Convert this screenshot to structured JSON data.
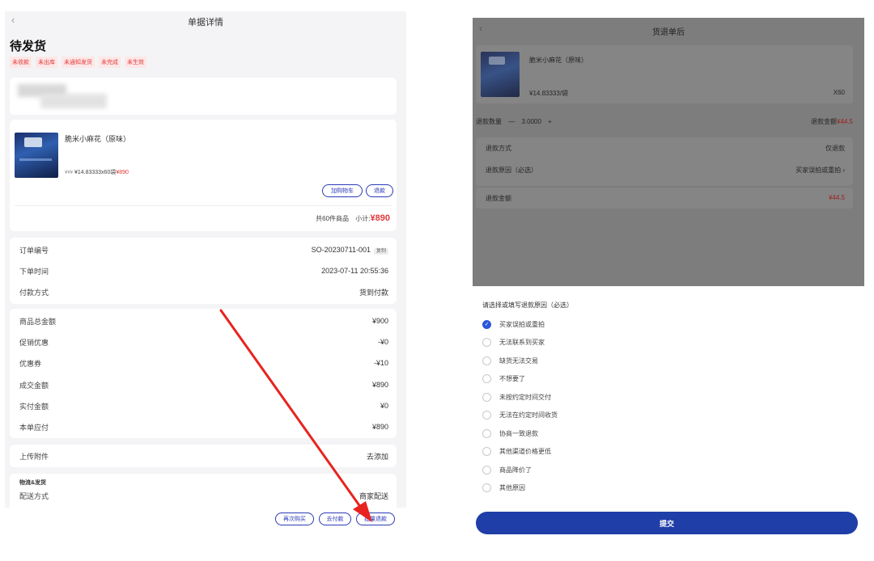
{
  "left": {
    "nav_title": "单据详情",
    "back_icon": "chevron-left-icon",
    "status": "待发货",
    "tags": [
      "未收款",
      "未出库",
      "未通知发货",
      "未完成",
      "未生效"
    ],
    "product": {
      "name": "脆米小麻花（原味）",
      "price_line": "¥14.83333x60袋",
      "price_prefix": "¥¥¥",
      "price_total": "¥890",
      "add_cart_label": "加购物车",
      "refund_label": "退款",
      "summary_count": "共60件商品",
      "summary_subtotal_label": "小计:",
      "summary_subtotal_value": "¥890"
    },
    "order_info": [
      {
        "label": "订单编号",
        "value": "SO-20230711-001",
        "badge": "复制"
      },
      {
        "label": "下单时间",
        "value": "2023-07-11 20:55:36"
      },
      {
        "label": "付款方式",
        "value": "货到付款"
      }
    ],
    "amounts": [
      {
        "label": "商品总金额",
        "value": "¥900",
        "red": false
      },
      {
        "label": "促销优惠",
        "value": "-¥0",
        "red": true
      },
      {
        "label": "优惠券",
        "value": "-¥10",
        "red": true
      },
      {
        "label": "成交金额",
        "value": "¥890",
        "red": false
      },
      {
        "label": "实付金额",
        "value": "¥0",
        "red": false
      },
      {
        "label": "本单应付",
        "value": "¥890",
        "red": false
      }
    ],
    "attachment": {
      "label": "上传附件",
      "action": "去添加"
    },
    "logistics": {
      "header": "物流&发货",
      "label": "配送方式",
      "value": "商家配送"
    },
    "bottom_buttons": [
      "再次购买",
      "去付款",
      "批量退款"
    ],
    "colors": {
      "accent": "#2b3bb8",
      "red": "#e23a3a",
      "arrow": "#e8231f"
    }
  },
  "right": {
    "nav_title": "货退单后",
    "back_icon": "chevron-left-icon",
    "product": {
      "name": "脆米小麻花（原味）",
      "price": "¥14.83333/袋",
      "qty": "X60"
    },
    "refund_qty": {
      "label": "退款数量",
      "minus": "—",
      "value": "3.0000",
      "plus": "+",
      "amount_label": "退款金额",
      "amount_value": "¥44.5"
    },
    "refund_method": {
      "label": "退款方式",
      "value": "仅退款"
    },
    "refund_reason": {
      "label": "退款原因（必选）",
      "value": "买家误拍或重拍",
      "arrow": "›"
    },
    "refund_amount": {
      "label": "退款金额",
      "value": "¥44.5"
    },
    "sheet": {
      "title": "请选择或填写退款原因（必选）",
      "options": [
        "买家误拍或重拍",
        "无法联系到买家",
        "缺货无法交易",
        "不想要了",
        "未按约定时间交付",
        "无法在约定时间收货",
        "协商一致退款",
        "其他渠道价格更低",
        "商品降价了",
        "其他原因"
      ],
      "selected_index": 0
    },
    "submit_label": "提交",
    "colors": {
      "overlay": "#7d7d7d",
      "primary": "#1f3ea8",
      "check": "#2b57d9"
    }
  }
}
